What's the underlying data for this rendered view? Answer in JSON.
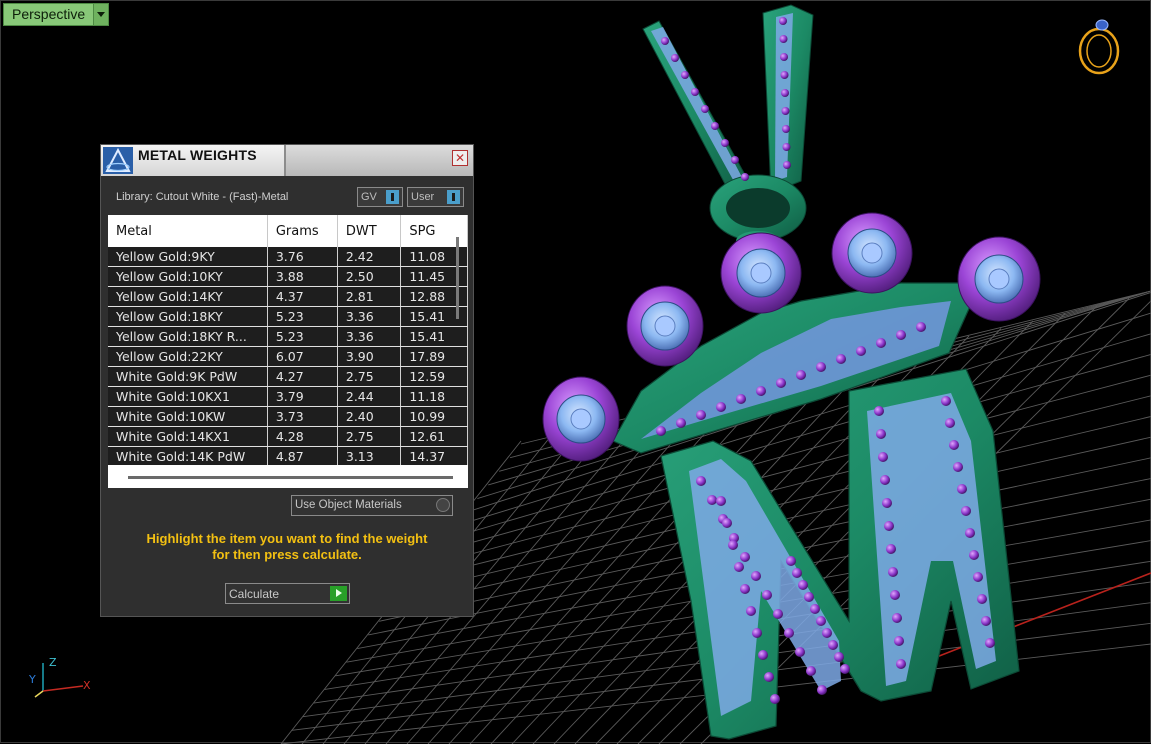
{
  "viewport": {
    "label": "Perspective",
    "view_menu_icon": "dropdown-arrow-icon"
  },
  "panel": {
    "title": "METAL WEIGHTS",
    "logo_icon": "app-logo-icon",
    "close_icon": "close-icon",
    "library": "Library: Cutout White - (Fast)-Metal",
    "toggles": {
      "gv": "GV",
      "user": "User"
    },
    "table": {
      "columns": [
        "Metal",
        "Grams",
        "DWT",
        "SPG"
      ],
      "rows": [
        {
          "metal": "Yellow Gold:9KY",
          "grams": "3.76",
          "dwt": "2.42",
          "spg": "11.08"
        },
        {
          "metal": "Yellow Gold:10KY",
          "grams": "3.88",
          "dwt": "2.50",
          "spg": "11.45"
        },
        {
          "metal": "Yellow Gold:14KY",
          "grams": "4.37",
          "dwt": "2.81",
          "spg": "12.88"
        },
        {
          "metal": "Yellow Gold:18KY",
          "grams": "5.23",
          "dwt": "3.36",
          "spg": "15.41"
        },
        {
          "metal": "Yellow Gold:18KY R...",
          "grams": "5.23",
          "dwt": "3.36",
          "spg": "15.41"
        },
        {
          "metal": "Yellow Gold:22KY",
          "grams": "6.07",
          "dwt": "3.90",
          "spg": "17.89"
        },
        {
          "metal": "White Gold:9K PdW",
          "grams": "4.27",
          "dwt": "2.75",
          "spg": "12.59"
        },
        {
          "metal": "White Gold:10KX1",
          "grams": "3.79",
          "dwt": "2.44",
          "spg": "11.18"
        },
        {
          "metal": "White Gold:10KW",
          "grams": "3.73",
          "dwt": "2.40",
          "spg": "10.99"
        },
        {
          "metal": "White Gold:14KX1",
          "grams": "4.28",
          "dwt": "2.75",
          "spg": "12.61"
        },
        {
          "metal": "White Gold:14K PdW",
          "grams": "4.87",
          "dwt": "3.13",
          "spg": "14.37"
        }
      ]
    },
    "use_object_materials": "Use Object Materials",
    "hint_line1": "Highlight the item you want to find the weight",
    "hint_line2": "for then press calculate.",
    "calculate_label": "Calculate",
    "calculate_icon": "play-icon"
  },
  "axis": {
    "z": "Z",
    "x": "X",
    "y": "Y"
  },
  "colors": {
    "metal": "#1f8f6a",
    "metal_dark": "#135d45",
    "stone": "#8cb8f2",
    "bezel": "#8a3bc4",
    "accent_green": "#88c878",
    "hint_yellow": "#f3c012"
  },
  "ring_widget_icon": "ring-navigator-icon"
}
